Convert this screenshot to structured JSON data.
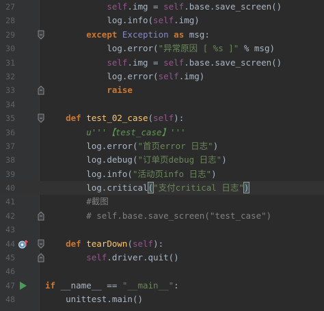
{
  "editor": {
    "lines": [
      {
        "num": "27",
        "indent": "            ",
        "tokens": [
          {
            "t": "self",
            "c": "self"
          },
          {
            "t": ".img = "
          },
          {
            "t": "self",
            "c": "self"
          },
          {
            "t": ".base.save_screen()"
          }
        ]
      },
      {
        "num": "28",
        "indent": "            ",
        "tokens": [
          {
            "t": "log.info("
          },
          {
            "t": "self",
            "c": "self"
          },
          {
            "t": ".img)"
          }
        ]
      },
      {
        "num": "29",
        "indent": "        ",
        "tokens": [
          {
            "t": "except ",
            "c": "kw"
          },
          {
            "t": "Exception",
            "c": "cls"
          },
          {
            "t": " "
          },
          {
            "t": "as",
            "c": "kw"
          },
          {
            "t": " msg:"
          }
        ],
        "fold": "open"
      },
      {
        "num": "30",
        "indent": "            ",
        "tokens": [
          {
            "t": "log.error("
          },
          {
            "t": "\"异常原因 [ %s ]\"",
            "c": "str"
          },
          {
            "t": " % msg)"
          }
        ]
      },
      {
        "num": "31",
        "indent": "            ",
        "tokens": [
          {
            "t": "self",
            "c": "self"
          },
          {
            "t": ".img = "
          },
          {
            "t": "self",
            "c": "self"
          },
          {
            "t": ".base.save_screen()"
          }
        ]
      },
      {
        "num": "32",
        "indent": "            ",
        "tokens": [
          {
            "t": "log.error("
          },
          {
            "t": "self",
            "c": "self"
          },
          {
            "t": ".img)"
          }
        ]
      },
      {
        "num": "33",
        "indent": "            ",
        "tokens": [
          {
            "t": "raise",
            "c": "kw"
          }
        ],
        "fold": "close"
      },
      {
        "num": "34",
        "indent": "",
        "tokens": []
      },
      {
        "num": "35",
        "indent": "    ",
        "tokens": [
          {
            "t": "def ",
            "c": "kw"
          },
          {
            "t": "test_02_case",
            "c": "fn"
          },
          {
            "t": "("
          },
          {
            "t": "self",
            "c": "self"
          },
          {
            "t": "):"
          }
        ],
        "fold": "open"
      },
      {
        "num": "36",
        "indent": "        ",
        "tokens": [
          {
            "t": "u'''【test_case】'''",
            "c": "doc"
          }
        ]
      },
      {
        "num": "37",
        "indent": "        ",
        "tokens": [
          {
            "t": "log.error("
          },
          {
            "t": "\"首页error 日志\"",
            "c": "str"
          },
          {
            "t": ")"
          }
        ]
      },
      {
        "num": "38",
        "indent": "        ",
        "tokens": [
          {
            "t": "log.debug("
          },
          {
            "t": "\"订单页debug 日志\"",
            "c": "str"
          },
          {
            "t": ")"
          }
        ]
      },
      {
        "num": "39",
        "indent": "        ",
        "tokens": [
          {
            "t": "log.info("
          },
          {
            "t": "\"活动页info 日志\"",
            "c": "str"
          },
          {
            "t": ")"
          }
        ]
      },
      {
        "num": "40",
        "indent": "        ",
        "current": true,
        "tokens": [
          {
            "t": "log.critical"
          },
          {
            "t": "(",
            "c": "brace"
          },
          {
            "t": "\"支付critical 日志\"",
            "c": "str"
          },
          {
            "t": ")",
            "c": "brace"
          },
          {
            "t": "",
            "c": "caret"
          }
        ]
      },
      {
        "num": "41",
        "indent": "        ",
        "tokens": [
          {
            "t": "#截图",
            "c": "cmt"
          }
        ]
      },
      {
        "num": "42",
        "indent": "        ",
        "tokens": [
          {
            "t": "# self.base.save_screen(\"test_case\")",
            "c": "cmt"
          }
        ],
        "fold": "close"
      },
      {
        "num": "43",
        "indent": "",
        "tokens": []
      },
      {
        "num": "44",
        "indent": "    ",
        "tokens": [
          {
            "t": "def ",
            "c": "kw"
          },
          {
            "t": "tearDown",
            "c": "fn"
          },
          {
            "t": "("
          },
          {
            "t": "self",
            "c": "self"
          },
          {
            "t": "):"
          }
        ],
        "fold": "open",
        "marker": "override"
      },
      {
        "num": "45",
        "indent": "        ",
        "tokens": [
          {
            "t": "self",
            "c": "self"
          },
          {
            "t": ".driver.quit()"
          }
        ],
        "fold": "close"
      },
      {
        "num": "46",
        "indent": "",
        "tokens": []
      },
      {
        "num": "47",
        "indent": "",
        "tokens": [
          {
            "t": "if ",
            "c": "kw"
          },
          {
            "t": "__name__ == "
          },
          {
            "t": "\"__main__\"",
            "c": "str"
          },
          {
            "t": ":"
          }
        ],
        "marker": "run"
      },
      {
        "num": "48",
        "indent": "    ",
        "tokens": [
          {
            "t": "unittest.main()"
          }
        ]
      }
    ]
  },
  "colors": {
    "background": "#2b2b2b",
    "gutter": "#313335",
    "keyword": "#cc7832",
    "string": "#6a8759",
    "self": "#94558d",
    "function": "#ffc66d",
    "comment": "#808080",
    "run_marker": "#499c54",
    "override_marker": "#6897bb"
  },
  "icons": {
    "fold_open": "fold-open-icon",
    "fold_close": "fold-close-icon",
    "run": "run-arrow-icon",
    "override": "override-method-icon"
  }
}
